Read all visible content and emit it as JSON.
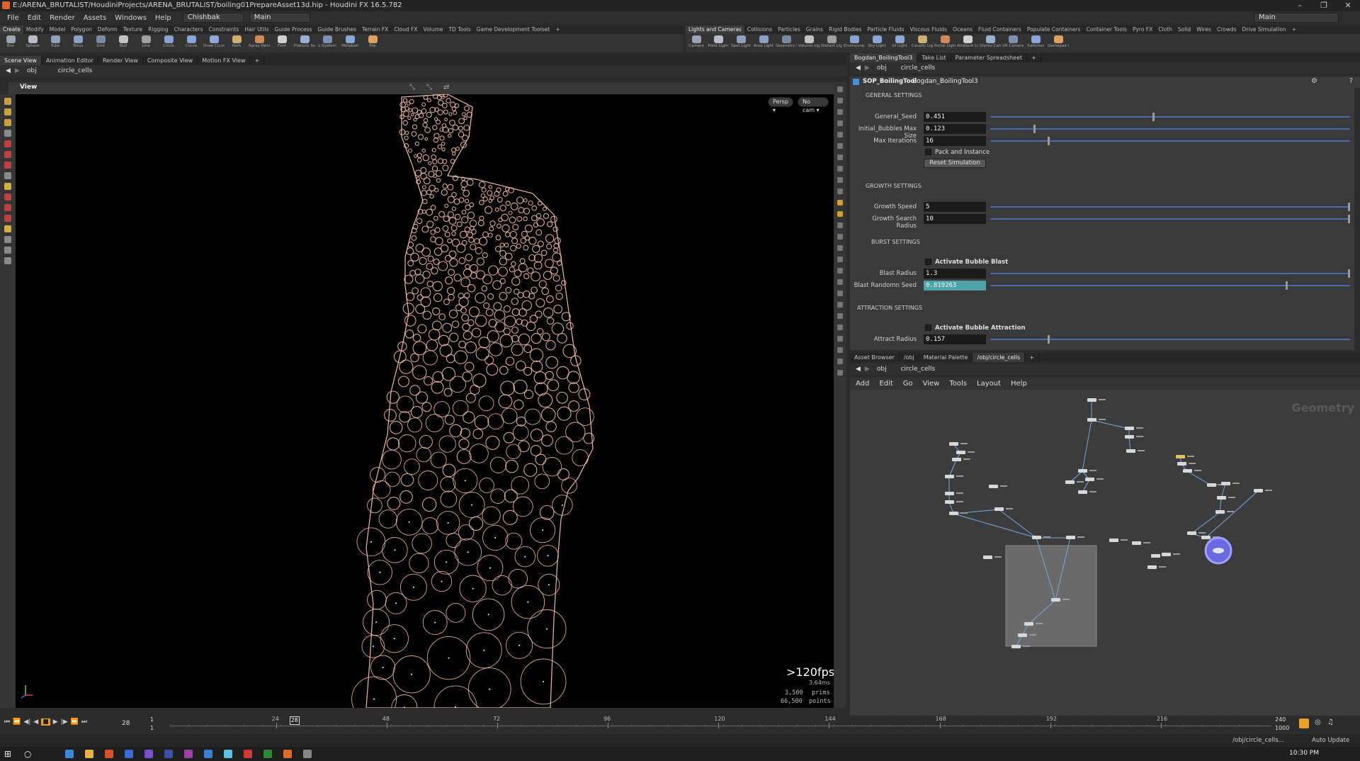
{
  "window": {
    "title": "E:/ARENA_BRUTALIST/HoudiniProjects/ARENA_BRUTALIST/boiling01PrepareAsset13d.hip - Houdini FX 16.5.782",
    "min_glyph": "–",
    "restore_glyph": "❐",
    "close_glyph": "✕"
  },
  "menubar": {
    "items": [
      "File",
      "Edit",
      "Render",
      "Assets",
      "Windows",
      "Help"
    ],
    "desktop": "Chishbak",
    "main": "Main",
    "right_main": "Main"
  },
  "shelf_left": {
    "tabs": [
      "Create",
      "Modify",
      "Model",
      "Polygon",
      "Deform",
      "Texture",
      "Rigging",
      "Characters",
      "Constraints",
      "Hair Utils",
      "Guide Process",
      "Guide Brushes",
      "Terrain FX",
      "Cloud FX",
      "Volume",
      "TD Tools",
      "Game Development Toolset",
      "+"
    ],
    "tools": [
      "Box",
      "Sphere",
      "Tube",
      "Torus",
      "Grid",
      "Null",
      "Line",
      "Circle",
      "Curve",
      "Draw Curve",
      "Path",
      "Spray Paint",
      "Font",
      "Platonic Solids",
      "L-System",
      "Metaball",
      "File"
    ]
  },
  "shelf_right": {
    "tabs": [
      "Lights and Cameras",
      "Collisions",
      "Particles",
      "Grains",
      "Rigid Bodies",
      "Particle Fluids",
      "Viscous Fluids",
      "Oceans",
      "Fluid Containers",
      "Populate Containers",
      "Container Tools",
      "Pyro FX",
      "Cloth",
      "Solid",
      "Wires",
      "Crowds",
      "Drive Simulation",
      "+"
    ],
    "tools": [
      "Camera",
      "Point Light",
      "Spot Light",
      "Area Light",
      "Geometry Light",
      "Volume Light",
      "Distant Light",
      "Environment Light",
      "Sky Light",
      "GI Light",
      "Caustic Light",
      "Portal Light",
      "Ambient Light",
      "Stereo Camera",
      "VR Camera",
      "Switcher",
      "Gamepad Camera"
    ]
  },
  "scene_pane": {
    "tabs": [
      "Scene View",
      "Animation Editor",
      "Render View",
      "Composite View",
      "Motion FX View",
      "+"
    ],
    "path": [
      "obj",
      "circle_cells"
    ],
    "view_label": "View",
    "persp": "Persp ▾",
    "cam": "No cam ▾",
    "fps": ">120fps",
    "ms": "3.64ms",
    "prims_value": "3,500",
    "prims_label": "prims",
    "points_value": "66,500",
    "points_label": "points"
  },
  "param_pane": {
    "tabs": [
      "Bogdan_BoilingTool3",
      "Take List",
      "Parameter Spreadsheet",
      "+"
    ],
    "path": [
      "obj",
      "circle_cells"
    ],
    "node_type": "SOP_BoilingTool",
    "node_name": "Bogdan_BoilingTool3",
    "sections": {
      "general": "GENERAL SETTINGS",
      "growth": "GROWTH SETTINGS",
      "burst": "BURST SETTINGS",
      "attraction": "ATTRACTION SETTINGS"
    },
    "params": {
      "general_seed": {
        "label": "General_Seed",
        "value": "0.451",
        "fraction": 0.45
      },
      "bubbles_max": {
        "label": "Initial_Bubbles Max Size",
        "value": "0.123",
        "fraction": 0.12
      },
      "max_iter": {
        "label": "Max Iterations",
        "value": "16",
        "fraction": 0.16
      },
      "pack": "Pack and Instance",
      "reset": "Reset Simulation",
      "growth_speed": {
        "label": "Growth Speed",
        "value": "5",
        "fraction": 1.0
      },
      "growth_radius": {
        "label": "Growth Search Radius",
        "value": "10",
        "fraction": 1.0
      },
      "activate_blast": "Activate Bubble Blast",
      "blast_radius": {
        "label": "Blast Radius",
        "value": "1.3",
        "fraction": 1.0
      },
      "blast_seed": {
        "label": "Blast Randomn Seed",
        "value": "0.819263",
        "fraction": 0.82
      },
      "activate_attract": "Activate Bubble Attraction",
      "attract_radius": {
        "label": "Attract Radius",
        "value": "0.157",
        "fraction": 0.16
      }
    }
  },
  "network_pane": {
    "tabs": [
      "Asset Browser",
      "/obj",
      "Material Palette",
      "/obj/circle_cells",
      "+"
    ],
    "path": [
      "obj",
      "circle_cells"
    ],
    "menu": [
      "Add",
      "Edit",
      "Go",
      "View",
      "Tools",
      "Layout",
      "Help"
    ],
    "context_label": "Geometry"
  },
  "timeline": {
    "current_frame": "28",
    "start": "1",
    "start2": "1",
    "end": "240",
    "end2": "1000",
    "ticks": [
      "24",
      "48",
      "72",
      "96",
      "120",
      "144",
      "168",
      "192",
      "216"
    ],
    "marker": "28"
  },
  "statusbar": {
    "path": "/obj/circle_cells...",
    "auto_update": "Auto Update",
    "clock": "10:30 PM"
  },
  "colors": {
    "wire": "#f0b9a0",
    "accent_blue": "#4b6aa8",
    "selected_field": "#4fa3a8",
    "houdini_orange": "#e2602a"
  }
}
